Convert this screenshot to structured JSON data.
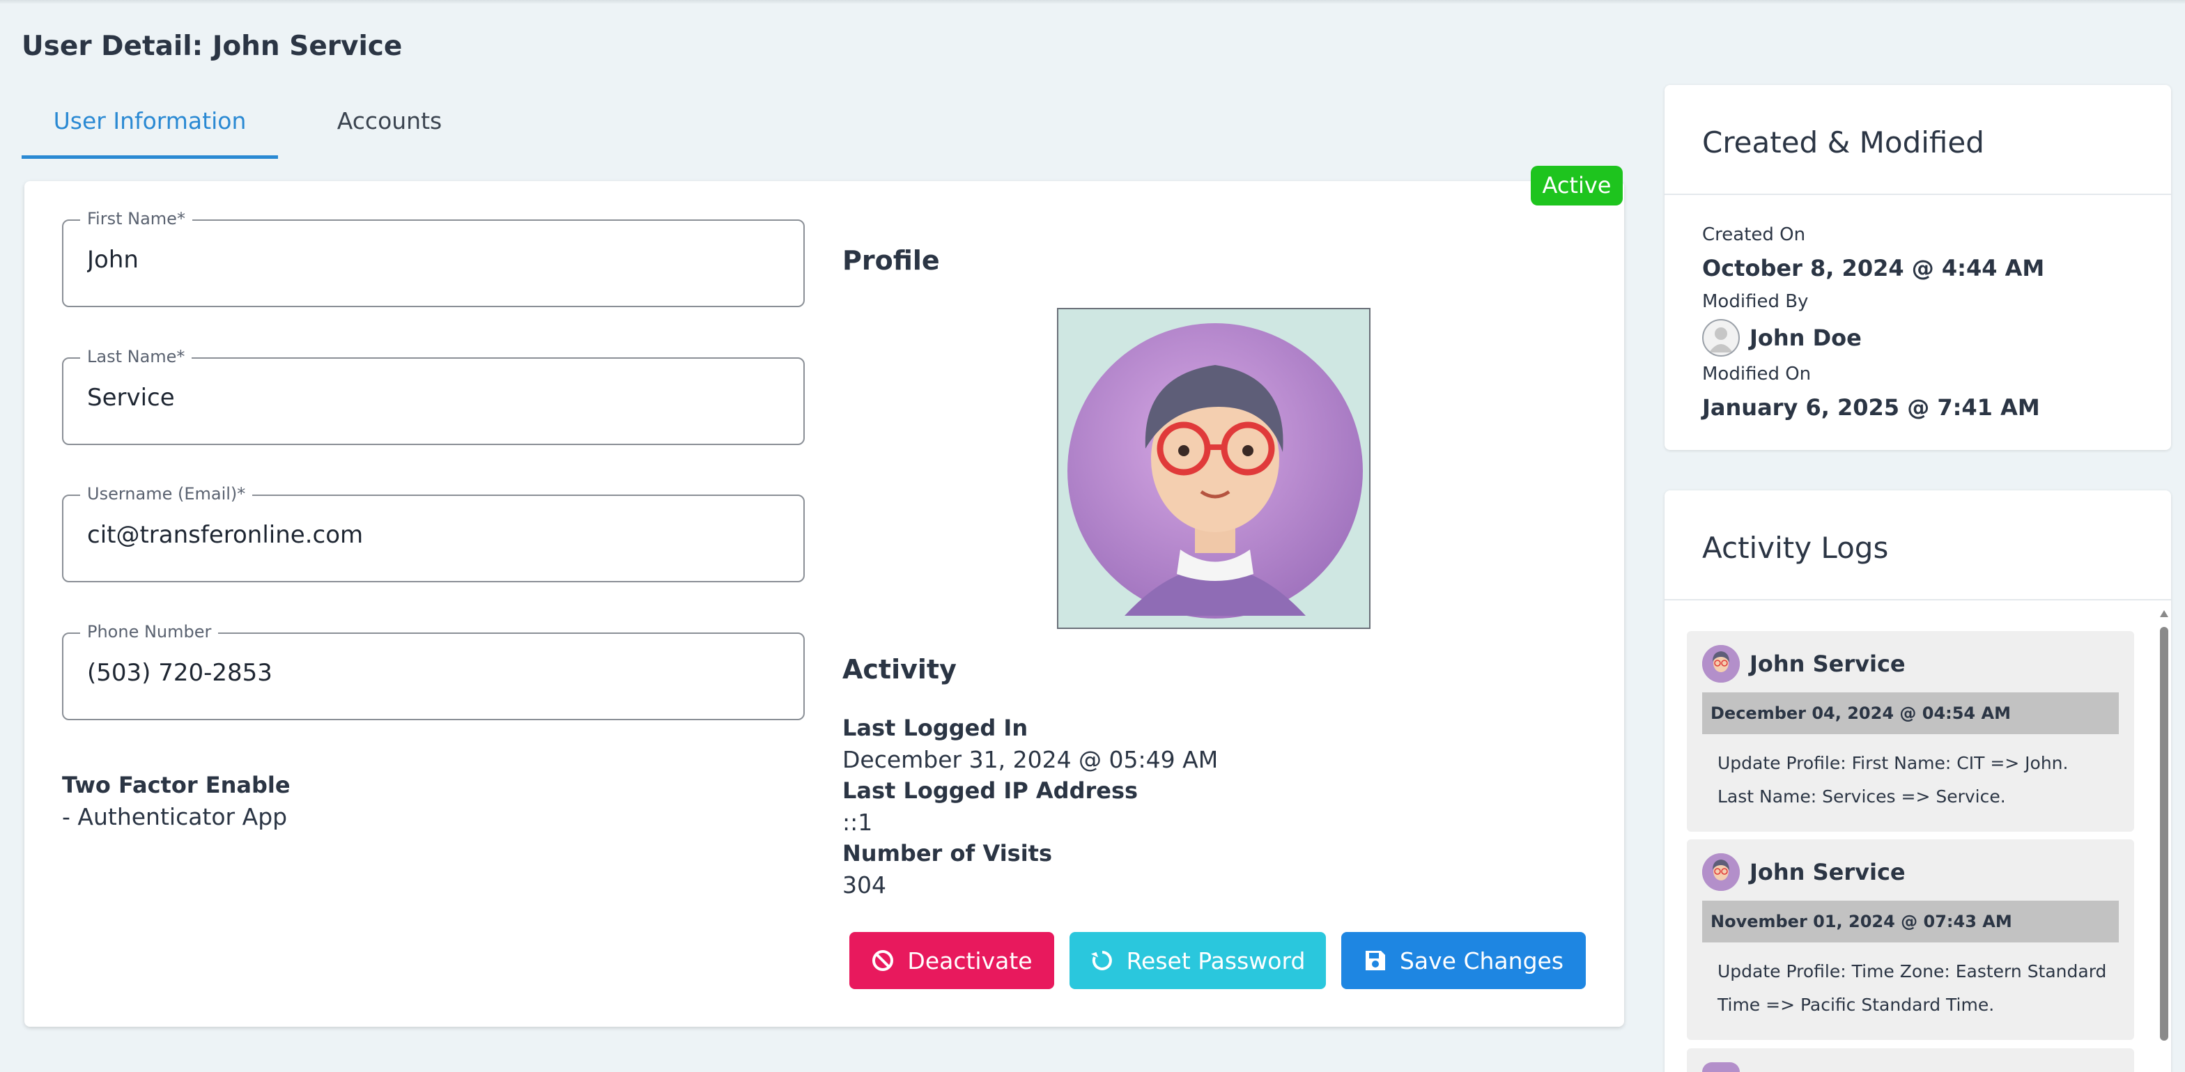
{
  "page": {
    "title": "User Detail: John Service"
  },
  "tabs": [
    {
      "label": "User Information",
      "active": true
    },
    {
      "label": "Accounts",
      "active": false
    }
  ],
  "status": {
    "label": "Active",
    "color": "#1ec41e"
  },
  "form": {
    "first_name": {
      "label": "First Name*",
      "value": "John"
    },
    "last_name": {
      "label": "Last Name*",
      "value": "Service"
    },
    "username": {
      "label": "Username (Email)*",
      "value": "cit@transferonline.com"
    },
    "phone": {
      "label": "Phone Number",
      "value": "(503) 720-2853"
    }
  },
  "two_factor": {
    "title": "Two Factor Enable",
    "value": "- Authenticator App"
  },
  "profile": {
    "title": "Profile"
  },
  "activity": {
    "title": "Activity",
    "last_logged_in_label": "Last Logged In",
    "last_logged_in": "December 31, 2024 @ 05:49 AM",
    "last_ip_label": "Last Logged IP Address",
    "last_ip": "::1",
    "visits_label": "Number of Visits",
    "visits": "304"
  },
  "buttons": {
    "deactivate": "Deactivate",
    "reset_password": "Reset Password",
    "save_changes": "Save Changes"
  },
  "created_modified": {
    "title": "Created & Modified",
    "created_on_label": "Created On",
    "created_on": "October 8, 2024 @ 4:44 AM",
    "modified_by_label": "Modified By",
    "modified_by": "John Doe",
    "modified_on_label": "Modified On",
    "modified_on": "January 6, 2025 @ 7:41 AM"
  },
  "activity_logs": {
    "title": "Activity Logs",
    "items": [
      {
        "user": "John Service",
        "date": "December 04, 2024 @ 04:54 AM",
        "text": "Update Profile: First Name: CIT => John. Last Name: Services => Service."
      },
      {
        "user": "John Service",
        "date": "November 01, 2024 @ 07:43 AM",
        "text": "Update Profile: Time Zone: Eastern Standard Time => Pacific Standard Time."
      }
    ]
  },
  "colors": {
    "accent": "#2a89d3",
    "deactivate": "#e8195d",
    "reset": "#2ac7dd",
    "save": "#1e86e2"
  },
  "icons": {
    "deactivate": "ban-icon",
    "reset": "refresh-icon",
    "save": "floppy-disk-icon"
  }
}
